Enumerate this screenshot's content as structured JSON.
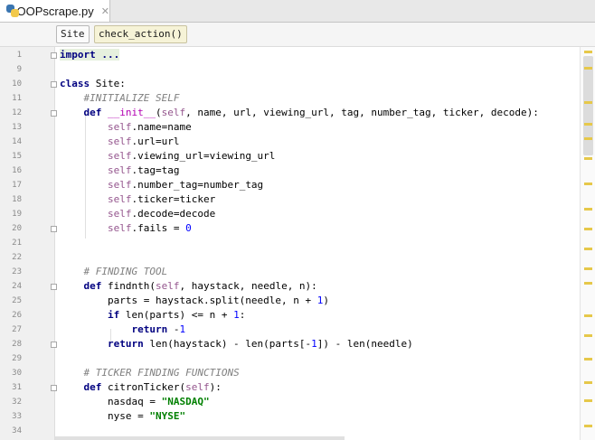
{
  "tabs": [
    {
      "label": "OOPscrape.py",
      "active": true,
      "close_glyph": "✕"
    }
  ],
  "breadcrumbs": [
    "Site",
    "check_action()"
  ],
  "colors": {
    "keyword": "#000080",
    "self": "#94558d",
    "number": "#0000ff",
    "string": "#008000",
    "comment": "#808080",
    "magic": "#b200b2",
    "scroll_mark": "#e6c84a"
  },
  "lines": [
    {
      "num": "1",
      "segments": [
        {
          "cls": "fold-text",
          "t": "import ..."
        }
      ],
      "fold": true
    },
    {
      "num": "9",
      "segments": []
    },
    {
      "num": "10",
      "segments": [
        {
          "cls": "kw",
          "t": "class "
        },
        {
          "cls": "",
          "t": "Site:"
        }
      ],
      "fold": true
    },
    {
      "num": "11",
      "segments": [
        {
          "cls": "",
          "t": "    "
        },
        {
          "cls": "cmt",
          "t": "#INITIALIZE SELF"
        }
      ]
    },
    {
      "num": "12",
      "segments": [
        {
          "cls": "",
          "t": "    "
        },
        {
          "cls": "kw",
          "t": "def "
        },
        {
          "cls": "magic",
          "t": "__init__"
        },
        {
          "cls": "",
          "t": "("
        },
        {
          "cls": "self",
          "t": "self"
        },
        {
          "cls": "",
          "t": ", name, url, viewing_url, tag, number_tag, ticker, decode):"
        }
      ],
      "fold": true
    },
    {
      "num": "13",
      "segments": [
        {
          "cls": "",
          "t": "        "
        },
        {
          "cls": "self",
          "t": "self"
        },
        {
          "cls": "",
          "t": ".name=name"
        }
      ]
    },
    {
      "num": "14",
      "segments": [
        {
          "cls": "",
          "t": "        "
        },
        {
          "cls": "self",
          "t": "self"
        },
        {
          "cls": "",
          "t": ".url=url"
        }
      ]
    },
    {
      "num": "15",
      "segments": [
        {
          "cls": "",
          "t": "        "
        },
        {
          "cls": "self",
          "t": "self"
        },
        {
          "cls": "",
          "t": ".viewing_url=viewing_url"
        }
      ]
    },
    {
      "num": "16",
      "segments": [
        {
          "cls": "",
          "t": "        "
        },
        {
          "cls": "self",
          "t": "self"
        },
        {
          "cls": "",
          "t": ".tag=tag"
        }
      ]
    },
    {
      "num": "17",
      "segments": [
        {
          "cls": "",
          "t": "        "
        },
        {
          "cls": "self",
          "t": "self"
        },
        {
          "cls": "",
          "t": ".number_tag=number_tag"
        }
      ]
    },
    {
      "num": "18",
      "segments": [
        {
          "cls": "",
          "t": "        "
        },
        {
          "cls": "self",
          "t": "self"
        },
        {
          "cls": "",
          "t": ".ticker=ticker"
        }
      ]
    },
    {
      "num": "19",
      "segments": [
        {
          "cls": "",
          "t": "        "
        },
        {
          "cls": "self",
          "t": "self"
        },
        {
          "cls": "",
          "t": ".decode=decode"
        }
      ]
    },
    {
      "num": "20",
      "segments": [
        {
          "cls": "",
          "t": "        "
        },
        {
          "cls": "self",
          "t": "self"
        },
        {
          "cls": "",
          "t": ".fails = "
        },
        {
          "cls": "num",
          "t": "0"
        }
      ],
      "fold": true
    },
    {
      "num": "21",
      "segments": []
    },
    {
      "num": "22",
      "segments": []
    },
    {
      "num": "23",
      "segments": [
        {
          "cls": "",
          "t": "    "
        },
        {
          "cls": "cmt",
          "t": "# FINDING TOOL"
        }
      ]
    },
    {
      "num": "24",
      "segments": [
        {
          "cls": "",
          "t": "    "
        },
        {
          "cls": "kw",
          "t": "def "
        },
        {
          "cls": "fnname",
          "t": "findnth"
        },
        {
          "cls": "",
          "t": "("
        },
        {
          "cls": "self",
          "t": "self"
        },
        {
          "cls": "",
          "t": ", haystack, needle, n):"
        }
      ],
      "fold": true
    },
    {
      "num": "25",
      "segments": [
        {
          "cls": "",
          "t": "        parts = haystack.split(needle, n + "
        },
        {
          "cls": "num",
          "t": "1"
        },
        {
          "cls": "",
          "t": ")"
        }
      ]
    },
    {
      "num": "26",
      "segments": [
        {
          "cls": "",
          "t": "        "
        },
        {
          "cls": "kw",
          "t": "if "
        },
        {
          "cls": "",
          "t": "len(parts) <= n + "
        },
        {
          "cls": "num",
          "t": "1"
        },
        {
          "cls": "",
          "t": ":"
        }
      ]
    },
    {
      "num": "27",
      "segments": [
        {
          "cls": "",
          "t": "            "
        },
        {
          "cls": "kw",
          "t": "return "
        },
        {
          "cls": "",
          "t": "-"
        },
        {
          "cls": "num",
          "t": "1"
        }
      ]
    },
    {
      "num": "28",
      "segments": [
        {
          "cls": "",
          "t": "        "
        },
        {
          "cls": "kw",
          "t": "return "
        },
        {
          "cls": "",
          "t": "len(haystack) - len(parts[-"
        },
        {
          "cls": "num",
          "t": "1"
        },
        {
          "cls": "",
          "t": "]) - len(needle)"
        }
      ],
      "fold": true
    },
    {
      "num": "29",
      "segments": []
    },
    {
      "num": "30",
      "segments": [
        {
          "cls": "",
          "t": "    "
        },
        {
          "cls": "cmt",
          "t": "# TICKER FINDING FUNCTIONS"
        }
      ]
    },
    {
      "num": "31",
      "segments": [
        {
          "cls": "",
          "t": "    "
        },
        {
          "cls": "kw",
          "t": "def "
        },
        {
          "cls": "fnname",
          "t": "citronTicker"
        },
        {
          "cls": "",
          "t": "("
        },
        {
          "cls": "self",
          "t": "self"
        },
        {
          "cls": "",
          "t": "):"
        }
      ],
      "fold": true
    },
    {
      "num": "32",
      "segments": [
        {
          "cls": "",
          "t": "        nasdaq = "
        },
        {
          "cls": "str",
          "t": "\"NASDAQ\""
        }
      ]
    },
    {
      "num": "33",
      "segments": [
        {
          "cls": "",
          "t": "        nyse = "
        },
        {
          "cls": "str",
          "t": "\"NYSE\""
        }
      ]
    },
    {
      "num": "34",
      "segments": []
    }
  ]
}
